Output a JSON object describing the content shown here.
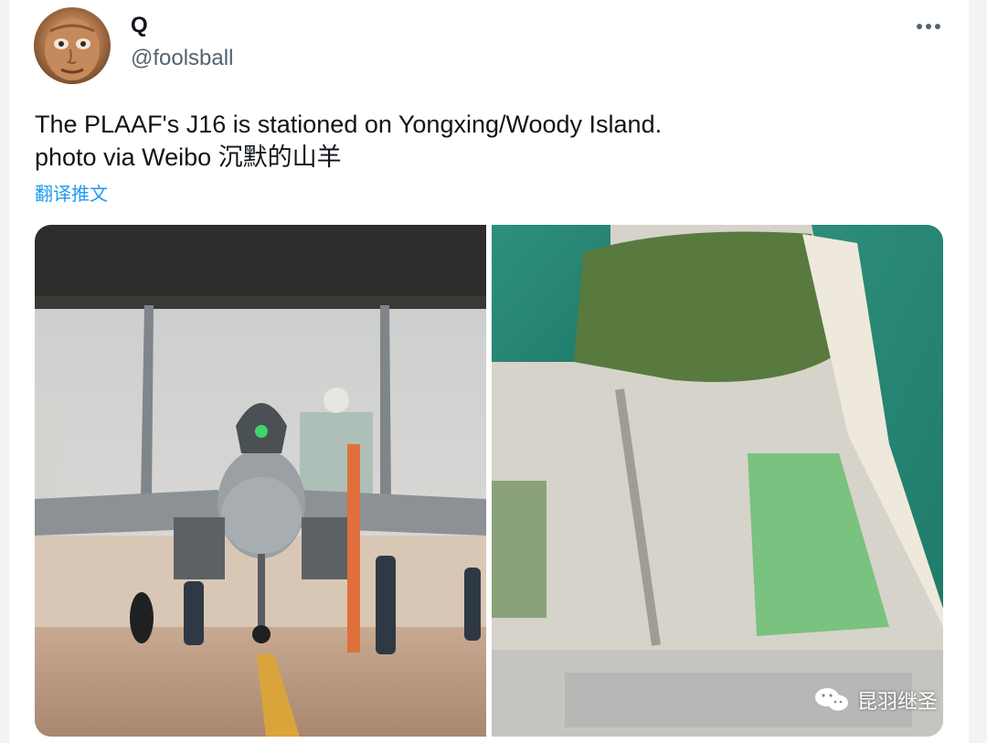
{
  "tweet": {
    "display_name": "Q",
    "handle": "@foolsball",
    "text_lines": [
      "The PLAAF's J16 is stationed on Yongxing/Woody Island.",
      "photo via Weibo 沉默的山羊"
    ],
    "translate_label": "翻译推文"
  },
  "icons": {
    "more": "more-horizontal-icon",
    "watermark": "wechat-icon"
  },
  "media": {
    "left_photo": "J-16 fighter jet parked in hangar",
    "right_photo": "satellite image of island with runway"
  },
  "watermark": {
    "text": "昆羽继圣"
  },
  "colors": {
    "text": "#0f1419",
    "secondary": "#536471",
    "link": "#1d9bf0"
  }
}
